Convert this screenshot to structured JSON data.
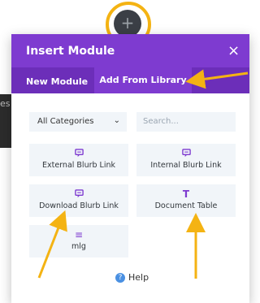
{
  "background": {
    "partial_text": "es"
  },
  "modal": {
    "title": "Insert Module",
    "close_symbol": "×",
    "tabs": [
      {
        "label": "New Module"
      },
      {
        "label": "Add From Library"
      }
    ],
    "category_select": {
      "value": "All Categories"
    },
    "search": {
      "placeholder": "Search..."
    },
    "cards": [
      {
        "label": "External Blurb Link",
        "icon": "comment-icon"
      },
      {
        "label": "Internal Blurb Link",
        "icon": "comment-icon"
      },
      {
        "label": "Download Blurb Link",
        "icon": "comment-icon"
      },
      {
        "label": "Document Table",
        "icon": "text-icon"
      },
      {
        "label": "mlg",
        "icon": "menu-icon"
      }
    ],
    "help": {
      "label": "Help"
    }
  },
  "colors": {
    "header_purple": "#7e3bd0",
    "tabs_purple": "#6c2eb9",
    "annotation_orange": "#f4b313",
    "card_bg": "#f1f5f9"
  }
}
